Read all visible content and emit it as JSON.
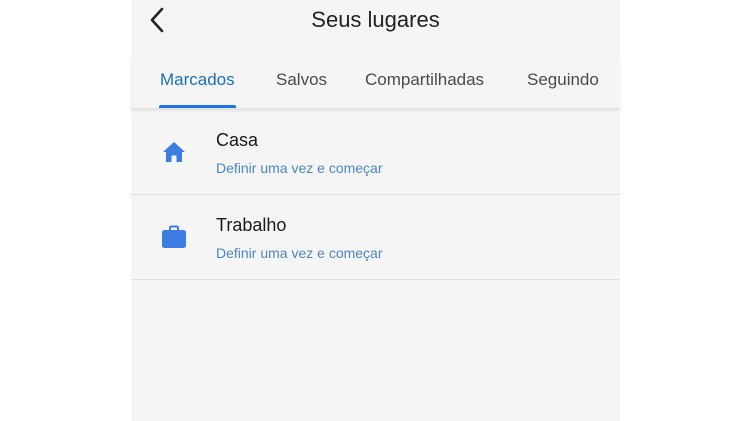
{
  "header": {
    "title": "Seus lugares",
    "back_icon": "back-arrow-icon"
  },
  "tabs": [
    {
      "label": "Marcados",
      "active": true
    },
    {
      "label": "Salvos",
      "active": false
    },
    {
      "label": "Compartilhadas",
      "active": false
    },
    {
      "label": "Seguindo",
      "active": false
    }
  ],
  "places": [
    {
      "title": "Casa",
      "subtitle": "Definir uma vez e começar",
      "icon": "home-icon"
    },
    {
      "title": "Trabalho",
      "subtitle": "Definir uma vez e começar",
      "icon": "briefcase-icon"
    }
  ],
  "colors": {
    "accent": "#1a73e8",
    "active_tab_text": "#1f6fb5",
    "subtitle": "#4a87c0",
    "icon": "#3b7de0",
    "background": "#f5f5f5"
  }
}
